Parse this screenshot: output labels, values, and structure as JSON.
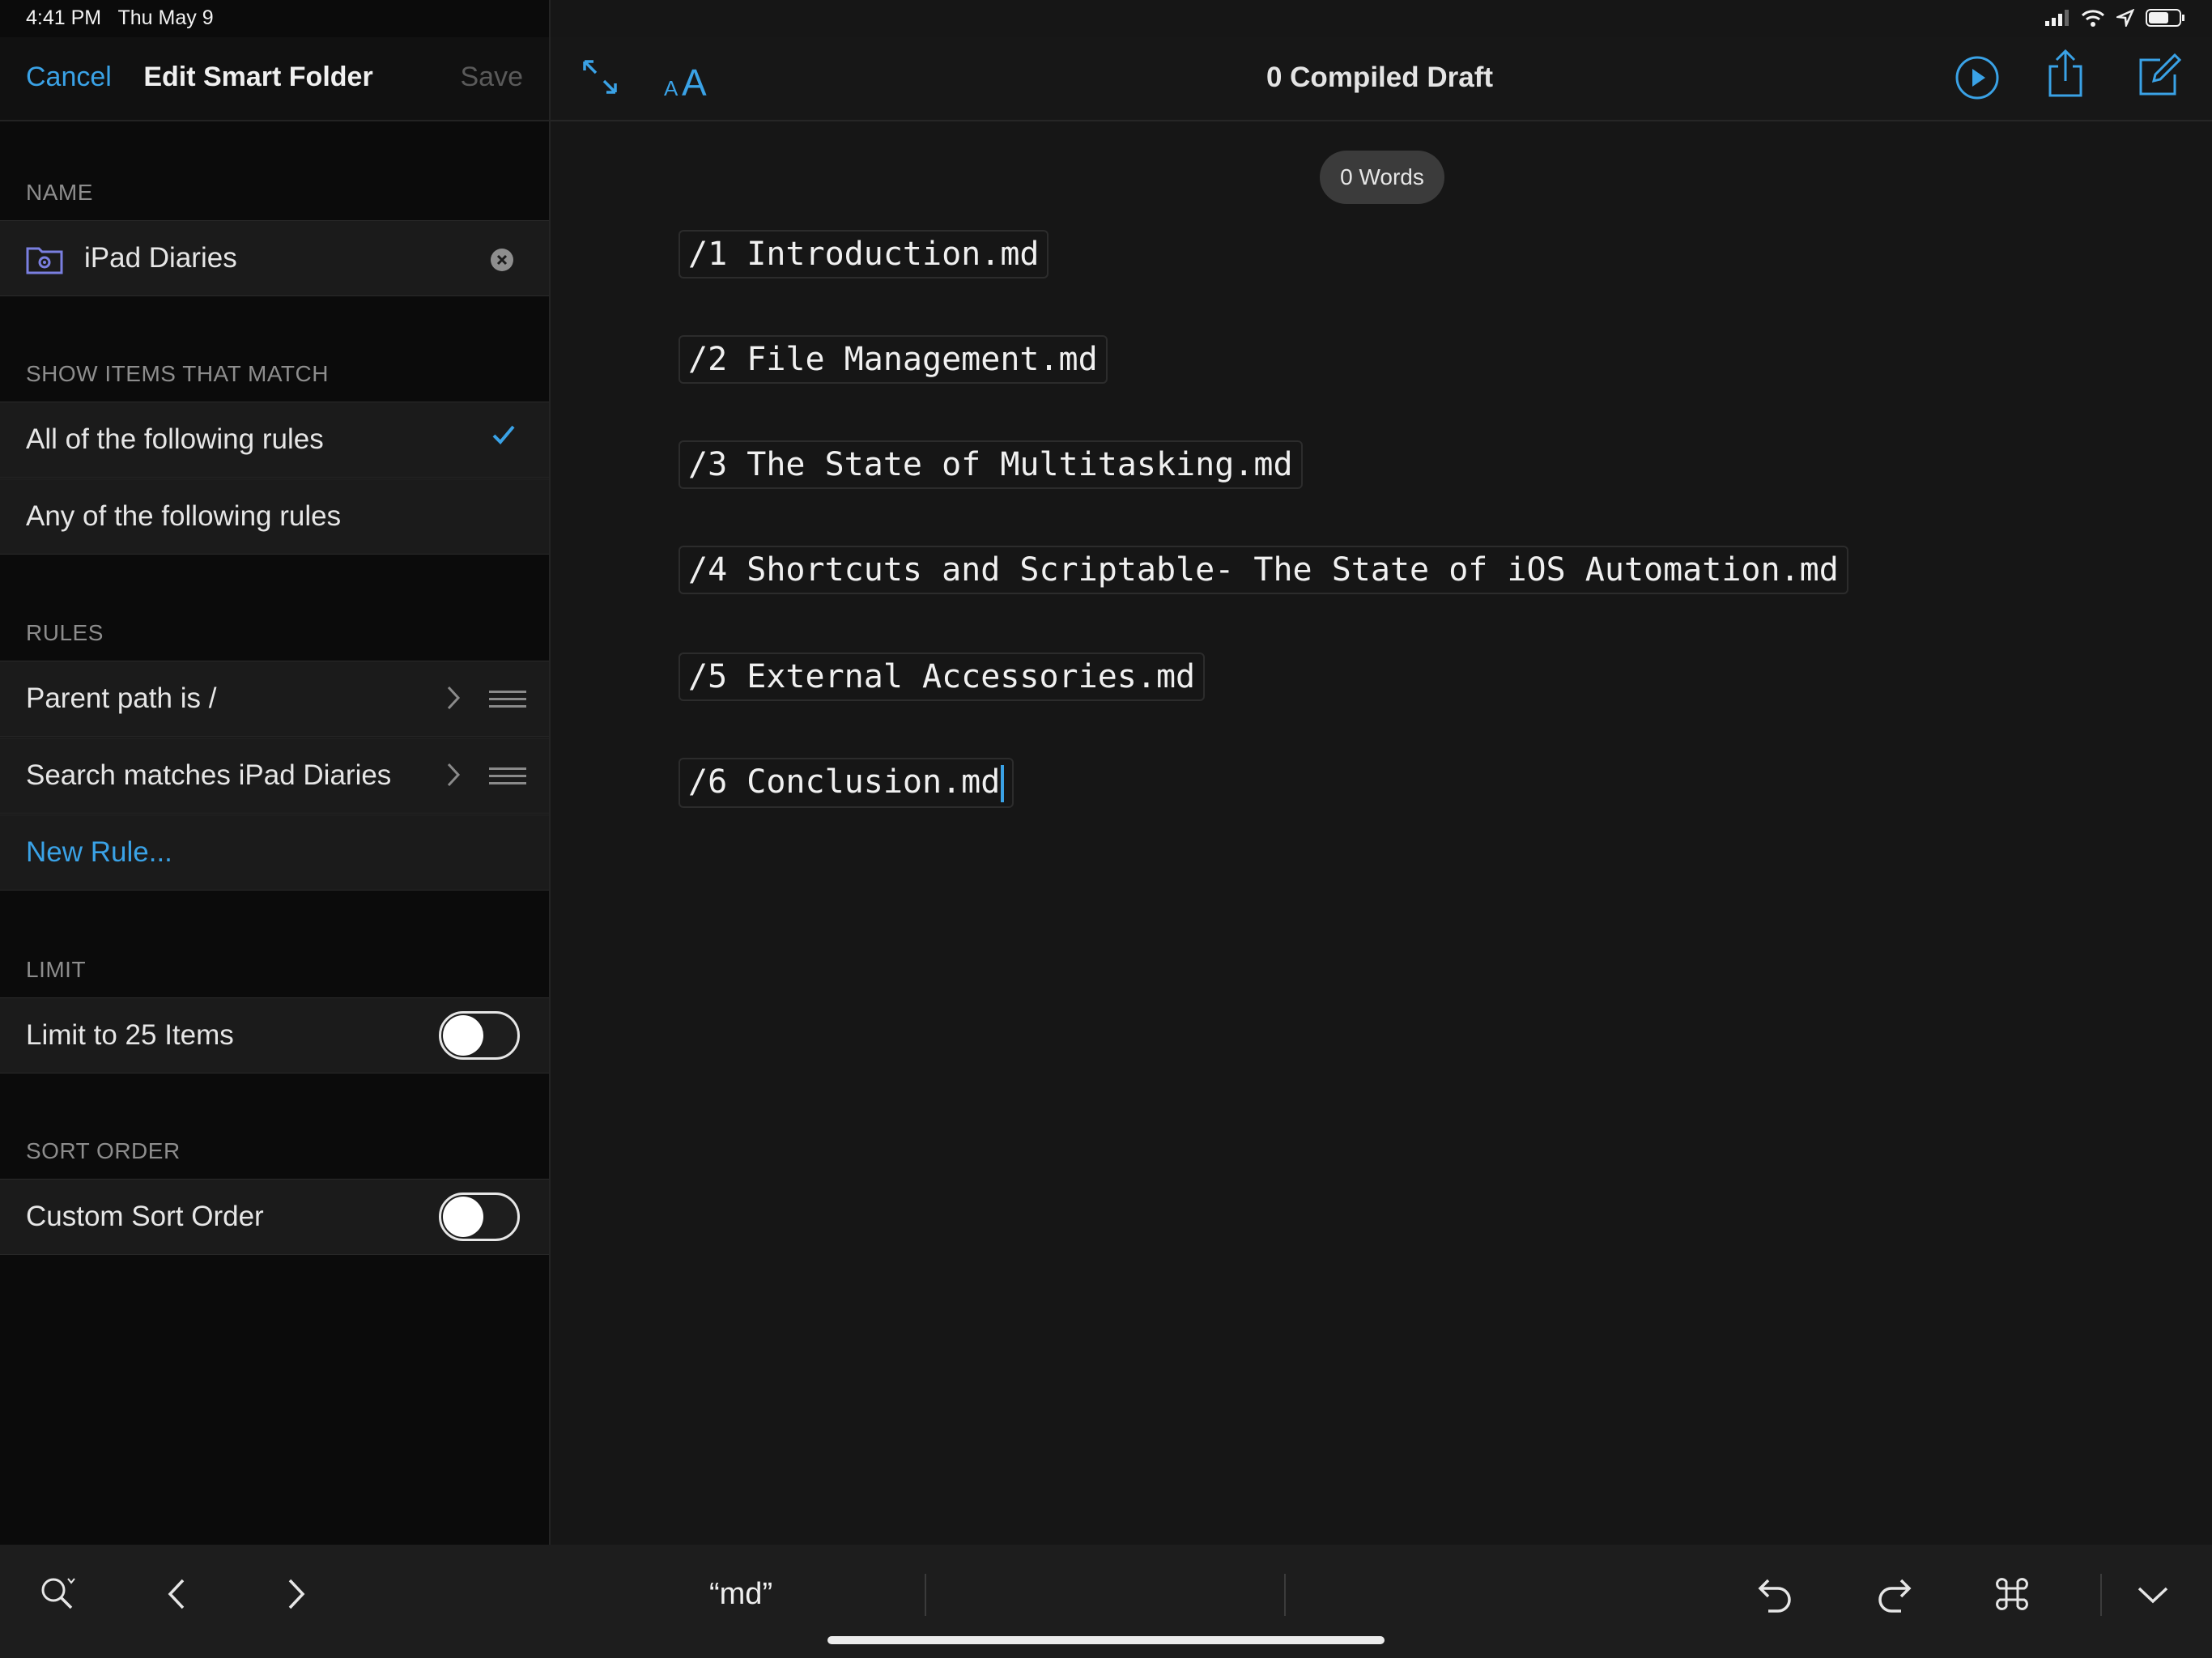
{
  "status": {
    "time": "4:41 PM",
    "date": "Thu May 9"
  },
  "sidebar": {
    "cancel_label": "Cancel",
    "title": "Edit Smart Folder",
    "save_label": "Save",
    "name_header": "NAME",
    "name_value": "iPad Diaries",
    "match_header": "SHOW ITEMS THAT MATCH",
    "match_options": [
      {
        "label": "All of the following rules",
        "selected": true
      },
      {
        "label": "Any of the following rules",
        "selected": false
      }
    ],
    "rules_header": "RULES",
    "rules": [
      {
        "label": "Parent path is /"
      },
      {
        "label": "Search matches iPad Diaries"
      }
    ],
    "new_rule_label": "New Rule...",
    "limit_header": "LIMIT",
    "limit_label": "Limit to 25 Items",
    "limit_enabled": false,
    "sort_header": "SORT ORDER",
    "sort_label": "Custom Sort Order",
    "sort_enabled": false
  },
  "editor": {
    "title": "0 Compiled Draft",
    "word_count": "0 Words",
    "lines": [
      "/1 Introduction.md",
      "/2 File Management.md",
      "/3 The State of Multitasking.md",
      "/4 Shortcuts and Scriptable- The State of iOS Automation.md",
      "/5 External Accessories.md",
      "/6 Conclusion.md"
    ]
  },
  "keyboard_bar": {
    "suggestion": "“md”"
  },
  "icons": {
    "expand": "expand-icon",
    "text_size": "text-size-icon",
    "play": "play-icon",
    "share": "share-icon",
    "compose": "compose-icon",
    "search": "search-icon",
    "back": "chevron-left-icon",
    "forward": "chevron-right-icon",
    "undo": "undo-icon",
    "redo": "redo-icon",
    "command": "command-icon",
    "dismiss": "chevron-down-icon",
    "folder": "smart-folder-icon"
  },
  "colors": {
    "accent": "#3aa2e6",
    "background": "#161616",
    "sidebar": "#0b0b0b"
  }
}
